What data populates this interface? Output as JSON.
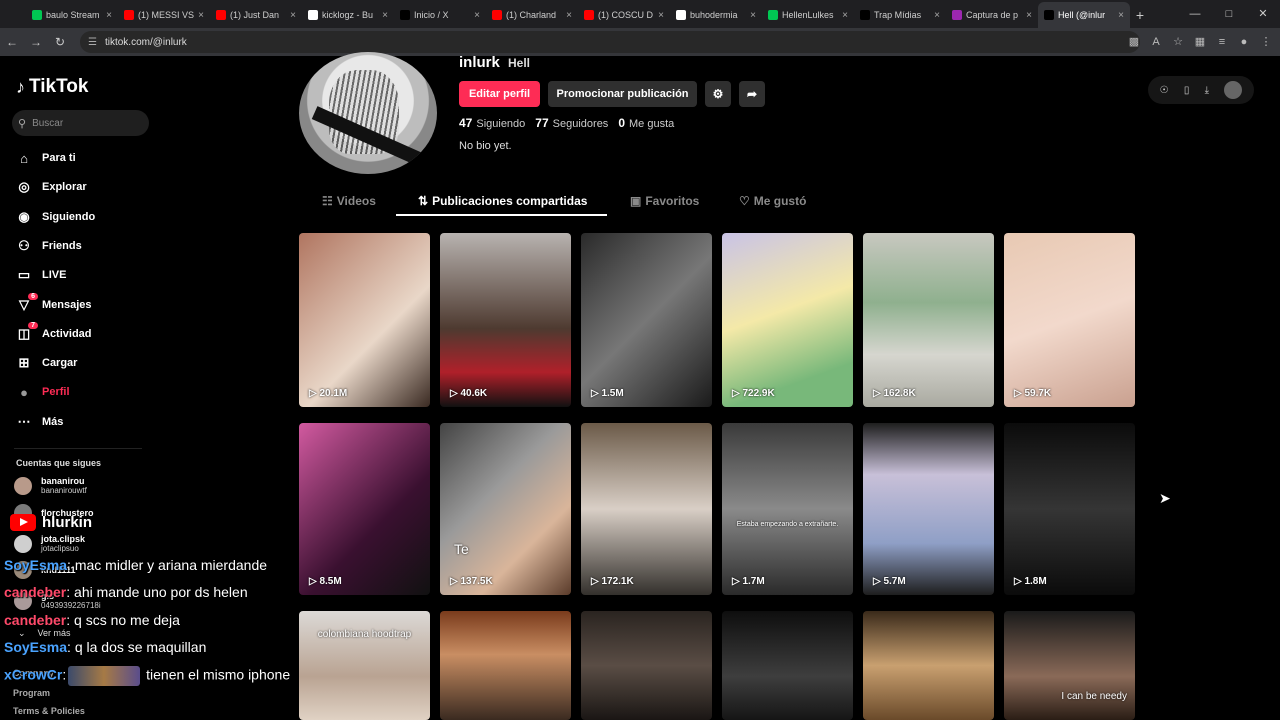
{
  "browser": {
    "tabs": [
      {
        "title": "baulo Stream",
        "fav": "#00c853"
      },
      {
        "title": "(1) MESSI VS",
        "fav": "#ff0000"
      },
      {
        "title": "(1) Just Dan",
        "fav": "#ff0000"
      },
      {
        "title": "kicklogz - Bu",
        "fav": "#ffffff"
      },
      {
        "title": "Inicio / X",
        "fav": "#000000"
      },
      {
        "title": "(1) Charland",
        "fav": "#ff0000"
      },
      {
        "title": "(1) COSCU D",
        "fav": "#ff0000"
      },
      {
        "title": "buhodermia",
        "fav": "#ffffff"
      },
      {
        "title": "HellenLulkes",
        "fav": "#00c853"
      },
      {
        "title": "Trap Mídias",
        "fav": "#000000"
      },
      {
        "title": "Captura de p",
        "fav": "#9c27b0"
      },
      {
        "title": "Hell (@inlur",
        "fav": "#000000"
      }
    ],
    "url": "tiktok.com/@inlurk"
  },
  "sidebar": {
    "logo": "TikTok",
    "search_placeholder": "Buscar",
    "nav": [
      {
        "label": "Para ti",
        "icon": "home-icon"
      },
      {
        "label": "Explorar",
        "icon": "compass-icon"
      },
      {
        "label": "Siguiendo",
        "icon": "following-icon"
      },
      {
        "label": "Friends",
        "icon": "friends-icon"
      },
      {
        "label": "LIVE",
        "icon": "live-icon"
      },
      {
        "label": "Mensajes",
        "icon": "messages-icon",
        "badge": "6"
      },
      {
        "label": "Actividad",
        "icon": "activity-icon",
        "badge": "7"
      },
      {
        "label": "Cargar",
        "icon": "upload-icon"
      },
      {
        "label": "Perfil",
        "icon": "profile-icon"
      },
      {
        "label": "Más",
        "icon": "more-icon"
      }
    ],
    "following_title": "Cuentas que sigues",
    "following": [
      {
        "name": "bananirou",
        "sub": "bananirouwtf"
      },
      {
        "name": "florchustero",
        "sub": ""
      },
      {
        "name": "jota.clipsk",
        "sub": "jotaclipsuo"
      },
      {
        "name": "knd1111",
        "sub": ""
      },
      {
        "name": "gis",
        "sub": "0493939226718i"
      }
    ],
    "ver_mas": "Ver más",
    "footer": [
      "Company",
      "Program",
      "Terms & Policies"
    ]
  },
  "chat": {
    "streamer": "hlurkin",
    "messages": [
      {
        "user": "SoyEsma",
        "text": ": mac midler y ariana mierdande"
      },
      {
        "user": "candeber",
        "text": ": ahi mande uno por ds helen"
      },
      {
        "user": "candeber",
        "text": ": q scs no me deja"
      },
      {
        "user": "SoyEsma",
        "text": ": q la dos se maquillan"
      },
      {
        "user": "xCrowCr",
        "text": ": tienen el mismo iphone"
      }
    ]
  },
  "profile": {
    "handle": "inlurk",
    "nickname": "Hell",
    "edit_label": "Editar perfil",
    "promo_label": "Promocionar publicación",
    "stats": [
      {
        "value": "47",
        "label": "Siguiendo"
      },
      {
        "value": "77",
        "label": "Seguidores"
      },
      {
        "value": "0",
        "label": "Me gusta"
      }
    ],
    "bio": "No bio yet.",
    "tabs": [
      {
        "label": "Videos",
        "icon": "grid-icon"
      },
      {
        "label": "Publicaciones compartidas",
        "icon": "repost-icon"
      },
      {
        "label": "Favoritos",
        "icon": "bookmark-icon"
      },
      {
        "label": "Me gustó",
        "icon": "heart-icon"
      }
    ]
  },
  "videos": [
    {
      "views": "20.1M",
      "caption": "",
      "bg": "linear-gradient(135deg,#b07560,#e9d7c8 60%,#3a2a22)"
    },
    {
      "views": "40.6K",
      "caption": "",
      "bg": "linear-gradient(180deg,#b8b3b0,#4e3a30 55%,#b0202a 80%,#111)"
    },
    {
      "views": "1.5M",
      "caption": "",
      "bg": "linear-gradient(135deg,#2a2a2a,#777 50%,#1a1a1a)"
    },
    {
      "views": "722.9K",
      "caption": "",
      "bg": "linear-gradient(160deg,#c9c3e6,#f4e9a8 45%,#78b87a 80%)"
    },
    {
      "views": "162.8K",
      "caption": "",
      "bg": "linear-gradient(180deg,#c8c8c0,#8fb08e 40%,#d6d6cf 70%,#a9a9a0)"
    },
    {
      "views": "59.7K",
      "caption": "",
      "bg": "linear-gradient(160deg,#e8c9b3,#f2d9cc 50%,#c9a08f)"
    },
    {
      "views": "8.5M",
      "caption": "",
      "bg": "linear-gradient(135deg,#d25aa0,#3a1030 60%,#111)"
    },
    {
      "views": "137.5K",
      "caption": "Te",
      "bg": "linear-gradient(135deg,#444,#9a9a9a 40%,#d9b59a 70%,#5a3b2a)"
    },
    {
      "views": "172.1K",
      "caption": "",
      "bg": "linear-gradient(180deg,#6b5a48,#d9cfc6 50%,#33302c)"
    },
    {
      "views": "1.7M",
      "caption": "Estaba empezando a extrañarte.",
      "bg": "linear-gradient(180deg,#3a3a3a,#8a8a8a 50%,#2a2a2a)"
    },
    {
      "views": "5.7M",
      "caption": "",
      "bg": "linear-gradient(180deg,#1e1e1e,#c8c0d8 30%,#8f9fc6 70%,#1e1e1e)"
    },
    {
      "views": "1.8M",
      "caption": "",
      "bg": "linear-gradient(180deg,#0b0b0b,#353535 50%,#0b0b0b)"
    },
    {
      "views": "",
      "caption": "colombiana hoodtrap",
      "bg": "linear-gradient(180deg,#dcd9d6,#b9a392 60%,#e0d2c4)"
    },
    {
      "views": "",
      "caption": "",
      "bg": "linear-gradient(180deg,#7a3b1c,#c98e63 40%,#3a2a20)"
    },
    {
      "views": "",
      "caption": "",
      "bg": "linear-gradient(180deg,#2a2420,#5a4d45 50%,#1a1614)"
    },
    {
      "views": "",
      "caption": "",
      "bg": "linear-gradient(180deg,#0e0e0e,#3e3e3e 60%,#151515)"
    },
    {
      "views": "",
      "caption": "",
      "bg": "linear-gradient(180deg,#3a2a1a,#c9a070 50%,#6a4a2a)"
    },
    {
      "views": "",
      "caption": "I can be needy",
      "bg": "linear-gradient(180deg,#1a1a1a,#8a6a58 60%,#2a1d15)"
    }
  ]
}
